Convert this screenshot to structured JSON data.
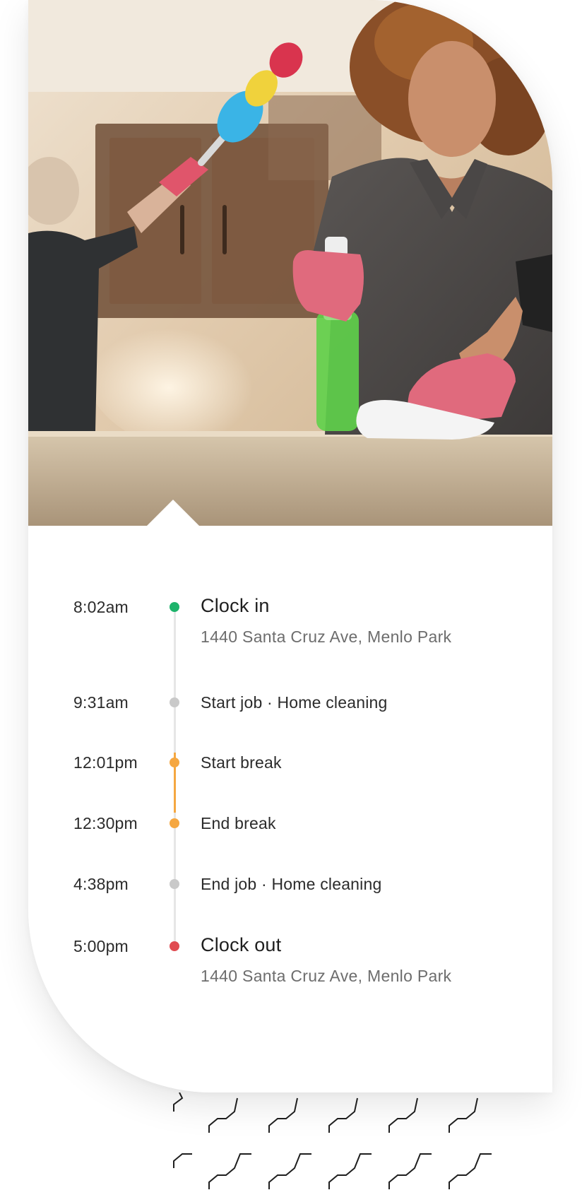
{
  "photo": {
    "icon": "cleaning-photo"
  },
  "timeline": {
    "entries": [
      {
        "time": "8:02am",
        "label": "Clock in",
        "sub": "1440 Santa Cruz Ave, Menlo Park",
        "dot_color": "#1db36b",
        "emphasis": true
      },
      {
        "time": "9:31am",
        "label": "Start job · Home cleaning",
        "dot_color": "#c9c9c9",
        "emphasis": false
      },
      {
        "time": "12:01pm",
        "label": "Start break",
        "dot_color": "#f5a741",
        "emphasis": false
      },
      {
        "time": "12:30pm",
        "label": "End break",
        "dot_color": "#f5a741",
        "emphasis": false
      },
      {
        "time": "4:38pm",
        "label": "End job · Home cleaning",
        "dot_color": "#c9c9c9",
        "emphasis": false
      },
      {
        "time": "5:00pm",
        "label": "Clock out",
        "sub": "1440 Santa Cruz Ave, Menlo Park",
        "dot_color": "#e04b51",
        "emphasis": true
      }
    ]
  },
  "colors": {
    "clock_in": "#1db36b",
    "break": "#f5a741",
    "job": "#c9c9c9",
    "clock_out": "#e04b51",
    "rail": "#e6e6e6"
  }
}
